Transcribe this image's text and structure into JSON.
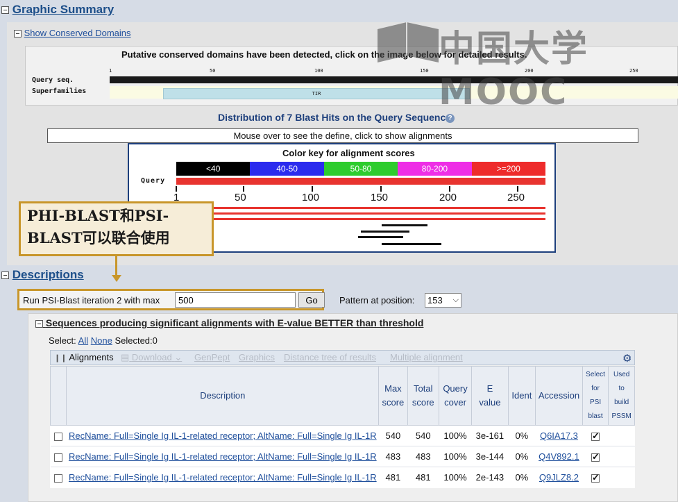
{
  "graphic_summary": {
    "title": "Graphic Summary",
    "cdd": {
      "toggle": "Show Conserved Domains",
      "message": "Putative conserved domains have been detected, click on the image below for detailed results.",
      "query_label": "Query seq.",
      "superfamilies_label": "Superfamilies",
      "domain_label": "TIR",
      "ticks": [
        "1",
        "50",
        "100",
        "150",
        "200",
        "250"
      ]
    },
    "distribution": {
      "title": "Distribution of 7 Blast Hits on the Query Sequence",
      "defline": "Mouse over to see the define, click to show alignments",
      "key_title": "Color key for alignment scores",
      "key": [
        {
          "label": "<40",
          "color": "#000000"
        },
        {
          "label": "40-50",
          "color": "#2b2bee"
        },
        {
          "label": "50-80",
          "color": "#2ecc2e"
        },
        {
          "label": "80-200",
          "color": "#ee2ee6"
        },
        {
          "label": ">=200",
          "color": "#ee2b2b"
        }
      ],
      "query_label": "Query",
      "axis": [
        "1",
        "50",
        "100",
        "150",
        "200",
        "250"
      ]
    }
  },
  "callout": {
    "line1": "PHI-BLAST和PSI-",
    "line2": "BLAST可以联合使用"
  },
  "descriptions": {
    "title": "Descriptions",
    "psi": {
      "label": "Run PSI-Blast iteration 2 with max",
      "value": "500",
      "go": "Go"
    },
    "pattern": {
      "label": "Pattern at position:",
      "selected": "153"
    },
    "sequences_title": "Sequences producing significant alignments with E-value BETTER than threshold",
    "select": {
      "label": "Select:",
      "all": "All",
      "none": "None",
      "selected": "Selected:0"
    },
    "toolbar": {
      "alignments": "Alignments",
      "download": "Download",
      "genpept": "GenPept",
      "graphics": "Graphics",
      "distance_tree": "Distance tree of results",
      "multiple_alignment": "Multiple alignment"
    },
    "columns": {
      "description": "Description",
      "max_score": [
        "Max",
        "score"
      ],
      "total_score": [
        "Total",
        "score"
      ],
      "query_cover": [
        "Query",
        "cover"
      ],
      "e_value": [
        "E",
        "value"
      ],
      "ident": "Ident",
      "accession": "Accession",
      "select_psi": [
        "Select",
        "for",
        "PSI",
        "blast"
      ],
      "used_pssm": [
        "Used",
        "to",
        "build",
        "PSSM"
      ]
    },
    "rows": [
      {
        "description": "RecName: Full=Single Ig IL-1-related receptor; AltName: Full=Single Ig IL-1R",
        "max": "540",
        "total": "540",
        "cover": "100%",
        "evalue": "3e-161",
        "ident": "0%",
        "accession": "Q6IA17.3"
      },
      {
        "description": "RecName: Full=Single Ig IL-1-related receptor; AltName: Full=Single Ig IL-1R",
        "max": "483",
        "total": "483",
        "cover": "100%",
        "evalue": "3e-144",
        "ident": "0%",
        "accession": "Q4V892.1"
      },
      {
        "description": "RecName: Full=Single Ig IL-1-related receptor; AltName: Full=Single Ig IL-1R",
        "max": "481",
        "total": "481",
        "cover": "100%",
        "evalue": "2e-143",
        "ident": "0%",
        "accession": "Q9JLZ8.2"
      }
    ]
  },
  "watermark": {
    "text": "中国大学MOOC"
  }
}
